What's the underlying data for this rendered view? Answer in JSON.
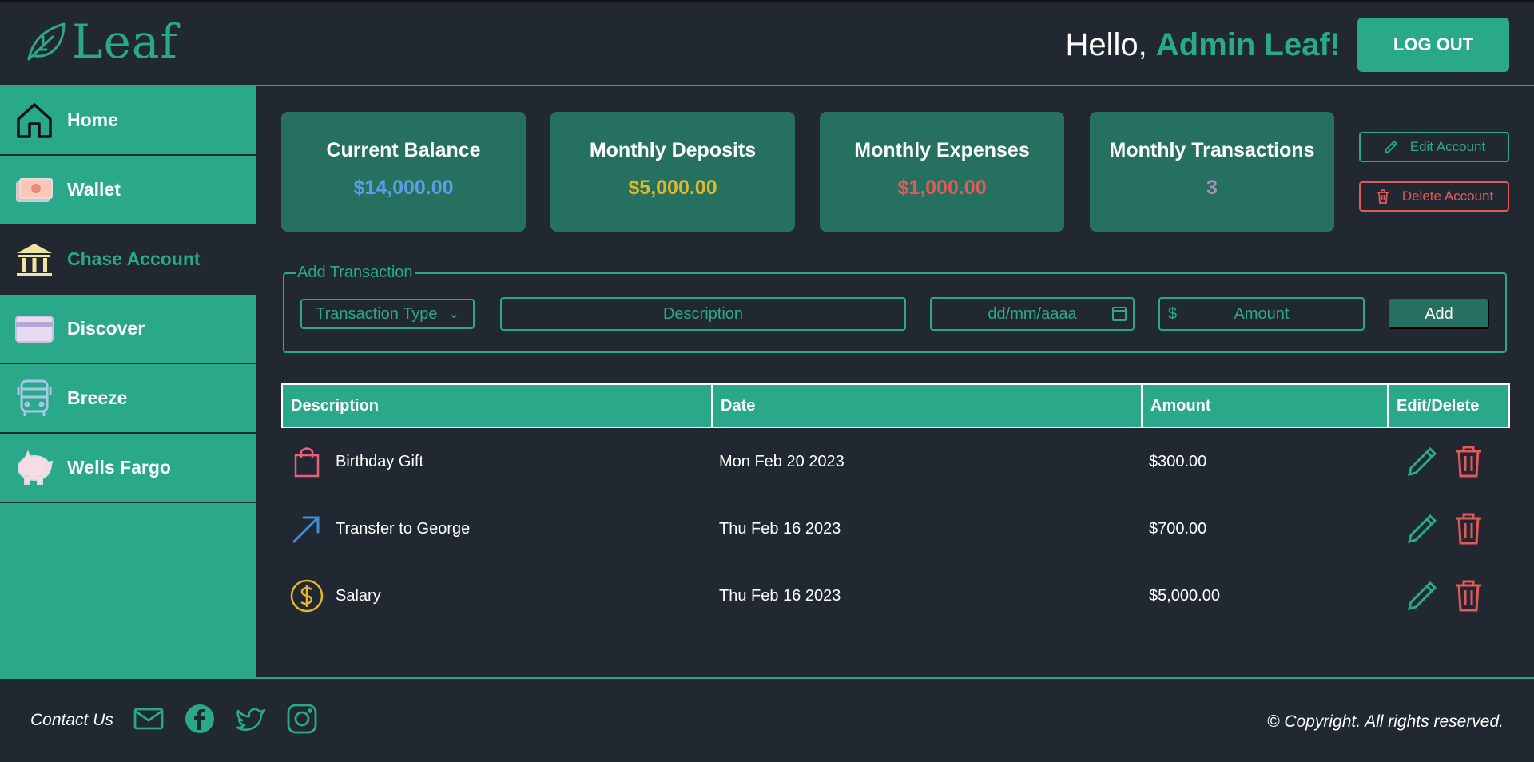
{
  "header": {
    "logo_text": "Leaf",
    "greeting": "Hello,",
    "user_name": "Admin Leaf!",
    "logout_label": "LOG OUT"
  },
  "sidebar": {
    "items": [
      {
        "label": "Home",
        "icon": "home-icon"
      },
      {
        "label": "Wallet",
        "icon": "cash-icon"
      },
      {
        "label": "Chase Account",
        "icon": "bank-icon",
        "active": true
      },
      {
        "label": "Discover",
        "icon": "credit-card-icon"
      },
      {
        "label": "Breeze",
        "icon": "bus-icon"
      },
      {
        "label": "Wells Fargo",
        "icon": "piggy-bank-icon"
      }
    ]
  },
  "cards": [
    {
      "title": "Current Balance",
      "value": "$14,000.00",
      "color": "#5b9ee8"
    },
    {
      "title": "Monthly Deposits",
      "value": "$5,000.00",
      "color": "#e0b72c"
    },
    {
      "title": "Monthly Expenses",
      "value": "$1,000.00",
      "color": "#e05a5a"
    },
    {
      "title": "Monthly Transactions",
      "value": "3",
      "color": "#a98fb8"
    }
  ],
  "account_actions": {
    "edit_label": "Edit Account",
    "delete_label": "Delete Account"
  },
  "add_transaction": {
    "legend": "Add Transaction",
    "type_placeholder": "Transaction Type",
    "description_placeholder": "Description",
    "date_placeholder": "dd/mm/aaaa",
    "currency_symbol": "$",
    "amount_placeholder": "Amount",
    "add_label": "Add"
  },
  "table": {
    "headers": [
      "Description",
      "Date",
      "Amount",
      "Edit/Delete"
    ],
    "rows": [
      {
        "icon": "shopping-bag-icon",
        "description": "Birthday Gift",
        "date": "Mon Feb 20 2023",
        "amount": "$300.00"
      },
      {
        "icon": "arrow-up-right-icon",
        "description": "Transfer to George",
        "date": "Thu Feb 16 2023",
        "amount": "$700.00"
      },
      {
        "icon": "dollar-coin-icon",
        "description": "Salary",
        "date": "Thu Feb 16 2023",
        "amount": "$5,000.00"
      }
    ]
  },
  "footer": {
    "contact_label": "Contact Us",
    "social_icons": [
      "mail-icon",
      "facebook-icon",
      "twitter-icon",
      "instagram-icon"
    ],
    "copyright": "© Copyright. All rights reserved."
  },
  "colors": {
    "accent": "#2aa98a",
    "background": "#222831",
    "card": "#26705f",
    "danger": "#e05a5a"
  }
}
